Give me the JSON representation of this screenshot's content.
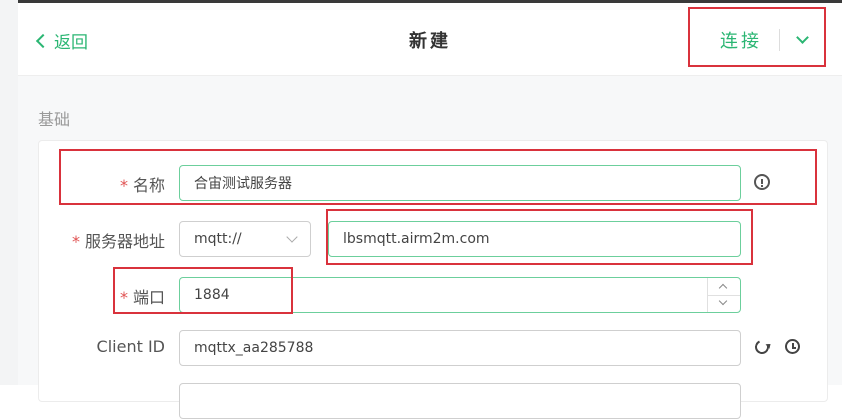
{
  "header": {
    "back_label": "返回",
    "title": "新建",
    "connect_label": "连接"
  },
  "section": {
    "basic_title": "基础"
  },
  "form": {
    "name": {
      "label": "名称",
      "required_mark": "*",
      "value": "合宙测试服务器"
    },
    "host": {
      "label": "服务器地址",
      "required_mark": "*",
      "protocol": "mqtt://",
      "value": "lbsmqtt.airm2m.com"
    },
    "port": {
      "label": "端口",
      "required_mark": "*",
      "value": "1884"
    },
    "client_id": {
      "label": "Client ID",
      "value": "mqttx_aa285788"
    }
  },
  "icons": {
    "back": "chevron-left-icon",
    "dropdown": "chevron-down-icon",
    "info": "info-circle-icon",
    "refresh": "refresh-icon",
    "history": "clock-icon"
  },
  "colors": {
    "accent": "#2bb673",
    "highlight": "#d9323c",
    "required": "#e05252"
  }
}
